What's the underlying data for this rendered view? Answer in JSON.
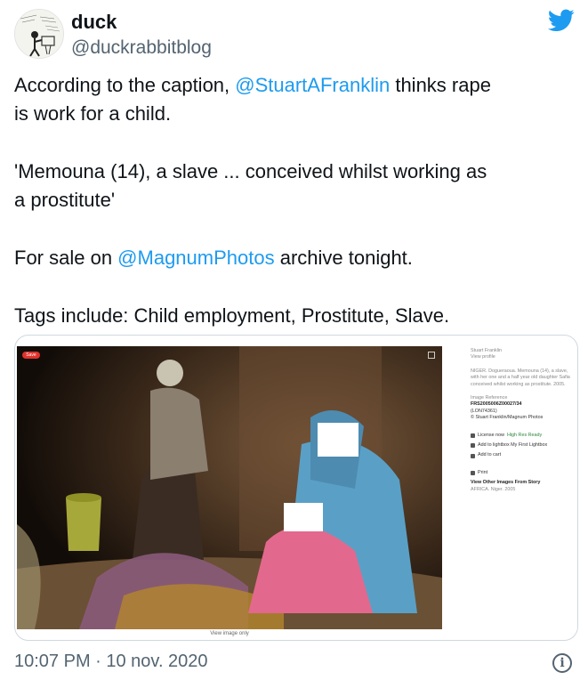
{
  "user": {
    "name": "duck",
    "handle": "@duckrabbitblog"
  },
  "tweet": {
    "line1_a": "According to the caption, ",
    "line1_mention": "@StuartAFranklin",
    "line1_b": " thinks rape",
    "line2": "is work for a child.",
    "line3": "'Memouna (14), a slave ... conceived whilst working as",
    "line4": "a prostitute'",
    "line5_a": "For sale on ",
    "line5_mention": "@MagnumPhotos",
    "line5_b": " archive tonight.",
    "line6": "Tags include: Child employment, Prostitute, Slave."
  },
  "media": {
    "save_badge": "Save",
    "view_only": "View image only",
    "info": {
      "photographer": "Stuart Franklin",
      "view_profile": "View profile",
      "caption": "NIGER. Dogueraoua. Memouna (14), a slave, with her one and a half year old daughter Safia conceived whilst working as prostitute. 2005.",
      "ref_label": "Image Reference",
      "ref_code": "FRS2005006Z00027/34",
      "ref_lon": "(LON74361)",
      "copyright": "© Stuart Franklin/Magnum Photos",
      "license": "License now",
      "hires": "High Res Ready",
      "lightbox": "Add to lightbox My First Lightbox",
      "cart": "Add to cart",
      "print": "Print",
      "other": "View Other Images From Story",
      "location": "AFRICA. Niger. 2005"
    }
  },
  "footer": {
    "timestamp": "10:07 PM · 10 nov. 2020"
  },
  "colors": {
    "accent": "#1d9bf0",
    "text": "#0f1419",
    "muted": "#536471"
  }
}
